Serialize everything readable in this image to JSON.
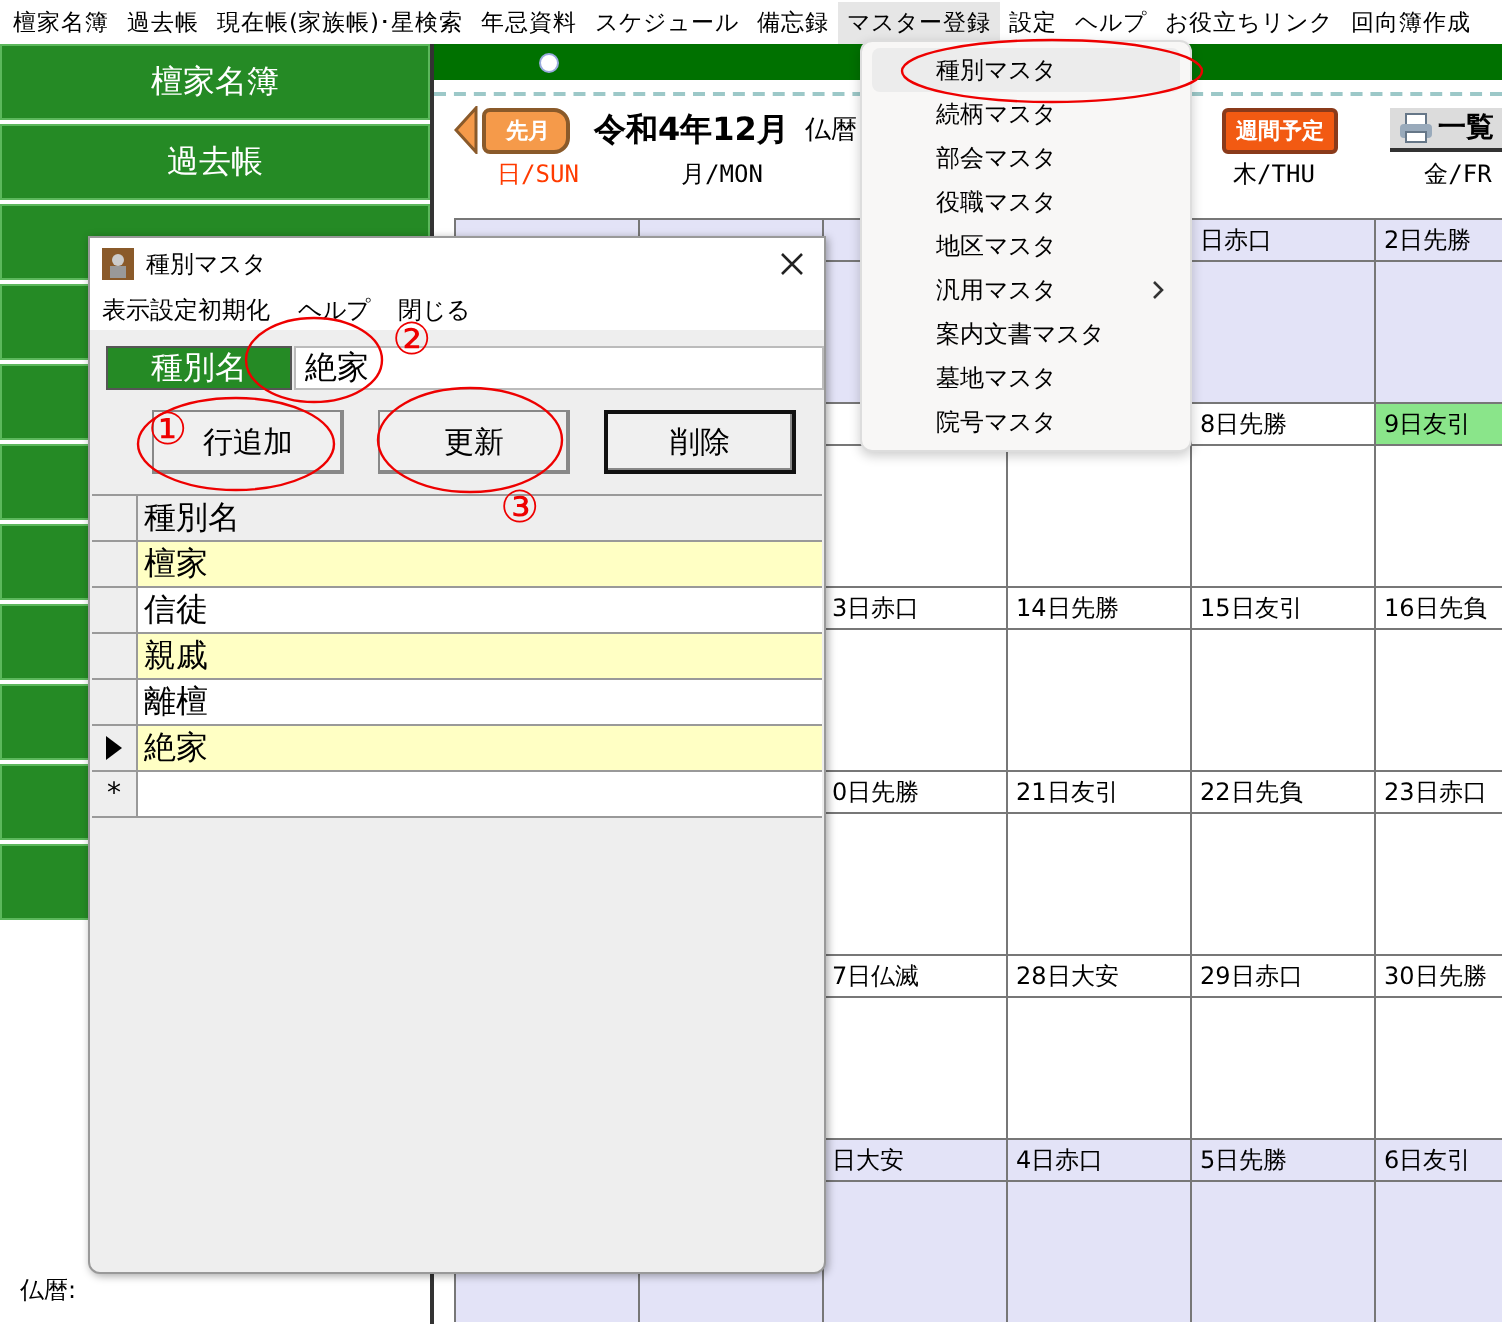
{
  "menubar": {
    "items": [
      {
        "label": "檀家名簿",
        "selected": false
      },
      {
        "label": "過去帳",
        "selected": false
      },
      {
        "label": "現在帳(家族帳)･星検索",
        "selected": false
      },
      {
        "label": "年忌資料",
        "selected": false
      },
      {
        "label": "スケジュール",
        "selected": false
      },
      {
        "label": "備忘録",
        "selected": false
      },
      {
        "label": "マスター登録",
        "selected": true
      },
      {
        "label": "設定",
        "selected": false
      },
      {
        "label": "ヘルプ",
        "selected": false
      },
      {
        "label": "お役立ちリンク",
        "selected": false
      },
      {
        "label": "回向簿作成",
        "selected": false
      }
    ]
  },
  "sidebar": {
    "buttons": [
      {
        "label": "檀家名簿"
      },
      {
        "label": "過去帳"
      }
    ],
    "footer": "仏暦:"
  },
  "calendar": {
    "prev_button": "先月",
    "month": "令和4年12月",
    "era": "仏暦",
    "week_button": "週間予定",
    "list_button": "一覧",
    "weekdays": [
      {
        "label": "日/SUN",
        "kind": "sunday"
      },
      {
        "label": "月/MON",
        "kind": "weekday"
      },
      {
        "kind": "weekday"
      },
      {
        "kind": "weekday"
      },
      {
        "label": "木/THU",
        "kind": "weekday"
      },
      {
        "label": "金/FR",
        "kind": "weekday"
      }
    ],
    "weeks": [
      {
        "shaded": true,
        "days": [
          {
            "label": "日赤口",
            "today": false
          },
          {
            "label": "2日先勝",
            "today": false
          }
        ]
      },
      {
        "shaded": false,
        "days": [
          {
            "label": "8日先勝",
            "today": false
          },
          {
            "label": "9日友引",
            "today": true
          }
        ]
      },
      {
        "shaded": false,
        "days": [
          {
            "label": "3日赤口",
            "today": false
          },
          {
            "label": "14日先勝",
            "today": false
          },
          {
            "label": "15日友引",
            "today": false
          },
          {
            "label": "16日先負",
            "today": false
          }
        ]
      },
      {
        "shaded": false,
        "days": [
          {
            "label": "0日先勝",
            "today": false
          },
          {
            "label": "21日友引",
            "today": false
          },
          {
            "label": "22日先負",
            "today": false
          },
          {
            "label": "23日赤口",
            "today": false
          }
        ]
      },
      {
        "shaded": false,
        "days": [
          {
            "label": "7日仏滅",
            "today": false
          },
          {
            "label": "28日大安",
            "today": false
          },
          {
            "label": "29日赤口",
            "today": false
          },
          {
            "label": "30日先勝",
            "today": false
          }
        ]
      },
      {
        "shaded": true,
        "days": [
          {
            "label": "日大安",
            "today": false
          },
          {
            "label": "4日赤口",
            "today": false
          },
          {
            "label": "5日先勝",
            "today": false
          },
          {
            "label": "6日友引",
            "today": false
          }
        ]
      }
    ]
  },
  "dropdown": {
    "items": [
      {
        "label": "種別マスタ",
        "selected": true,
        "submenu": false
      },
      {
        "label": "続柄マスタ",
        "selected": false,
        "submenu": false
      },
      {
        "label": "部会マスタ",
        "selected": false,
        "submenu": false
      },
      {
        "label": "役職マスタ",
        "selected": false,
        "submenu": false
      },
      {
        "label": "地区マスタ",
        "selected": false,
        "submenu": false
      },
      {
        "label": "汎用マスタ",
        "selected": false,
        "submenu": true
      },
      {
        "label": "案内文書マスタ",
        "selected": false,
        "submenu": false
      },
      {
        "label": "墓地マスタ",
        "selected": false,
        "submenu": false
      },
      {
        "label": "院号マスタ",
        "selected": false,
        "submenu": false
      }
    ]
  },
  "dialog": {
    "title": "種別マスタ",
    "menu": [
      "表示設定初期化",
      "ヘルプ",
      "閉じる"
    ],
    "field": {
      "label": "種別名",
      "value": "絶家"
    },
    "buttons": [
      {
        "label": "行追加",
        "default": false
      },
      {
        "label": "更新",
        "default": false
      },
      {
        "label": "削除",
        "default": true
      }
    ],
    "grid": {
      "column": "種別名",
      "new_row_marker": "*",
      "rows": [
        {
          "value": "檀家",
          "current": false
        },
        {
          "value": "信徒",
          "current": false
        },
        {
          "value": "親戚",
          "current": false
        },
        {
          "value": "離檀",
          "current": false
        },
        {
          "value": "絶家",
          "current": true
        }
      ]
    }
  },
  "annotations": {
    "marks": [
      "①",
      "②",
      "③"
    ]
  }
}
